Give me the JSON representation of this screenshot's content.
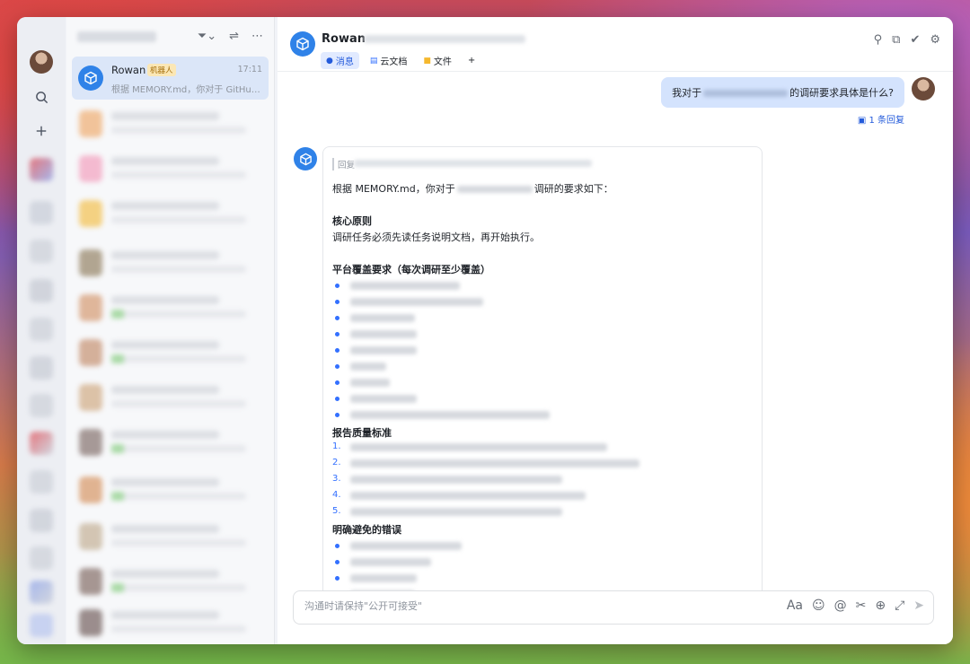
{
  "window": {
    "list": {
      "active_item": {
        "name": "Rowan",
        "tag": "机器人",
        "time": "17:11",
        "preview": "根据 MEMORY.md，你对于 GitHub ..."
      }
    },
    "chat": {
      "title": "Rowan",
      "tabs": [
        {
          "label": "消息",
          "icon": "message-icon"
        },
        {
          "label": "云文档",
          "icon": "doc-icon"
        },
        {
          "label": "文件",
          "icon": "folder-icon"
        }
      ],
      "add_tab": "+",
      "outgoing": {
        "prefix": "我对于",
        "suffix": "的调研要求具体是什么?"
      },
      "reply_count": "1 条回复",
      "reply_card": {
        "quote_label": "回复",
        "intro_prefix": "根据 MEMORY.md，你对于",
        "intro_suffix": "调研的要求如下：",
        "section1_title": "核心原则",
        "section1_text": "调研任务必须先读任务说明文档，再开始执行。",
        "section2_title": "平台覆盖要求（每次调研至少覆盖）",
        "section3_title": "报告质量标准",
        "numbers": [
          "1.",
          "2.",
          "3.",
          "4.",
          "5."
        ],
        "section4_title": "明确避免的错误"
      },
      "composer_placeholder": "沟通时请保持\"公开可接受\""
    }
  },
  "colors": {
    "accent": "#245bdb",
    "bot_avatar": "#2f82e8",
    "outgoing_bubble": "#d4e3fd"
  }
}
